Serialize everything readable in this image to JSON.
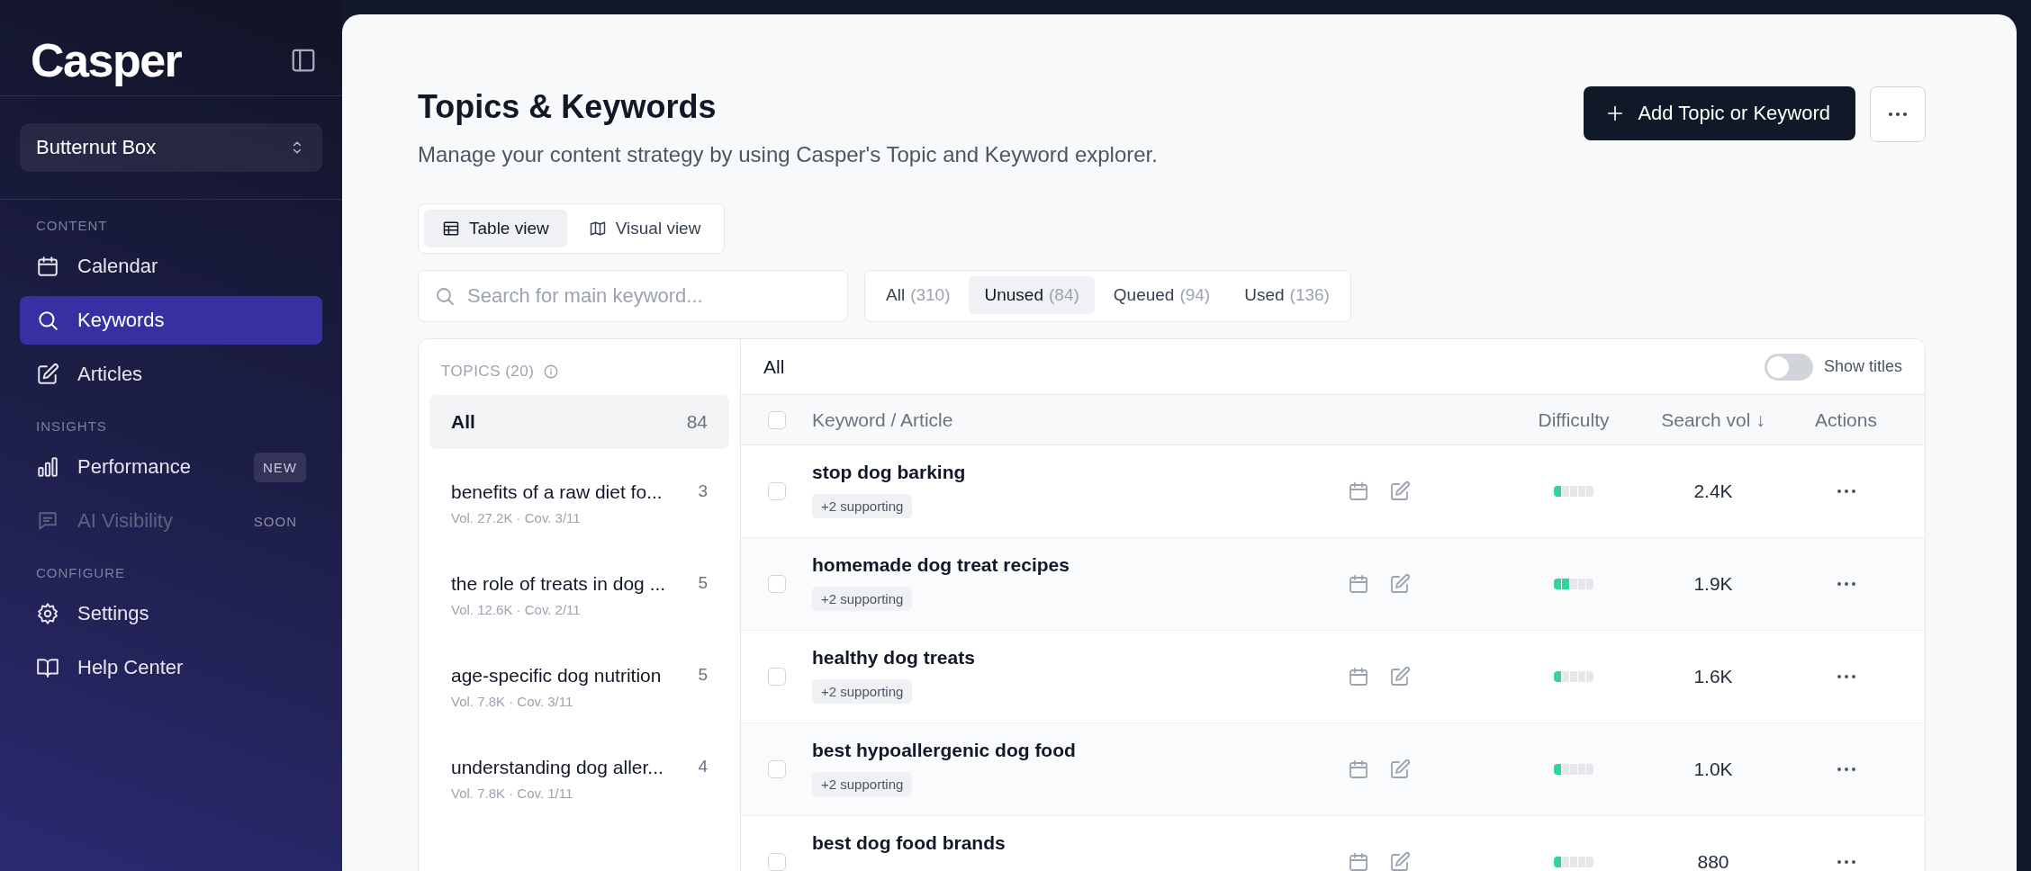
{
  "sidebar": {
    "logo": "Casper",
    "workspace": "Butternut Box",
    "sections": [
      {
        "heading": "CONTENT",
        "items": [
          {
            "label": "Calendar",
            "selected": false,
            "disabled": false
          },
          {
            "label": "Keywords",
            "selected": true,
            "disabled": false
          },
          {
            "label": "Articles",
            "selected": false,
            "disabled": false
          }
        ]
      },
      {
        "heading": "INSIGHTS",
        "items": [
          {
            "label": "Performance",
            "selected": false,
            "disabled": false,
            "badge": "NEW"
          },
          {
            "label": "AI Visibility",
            "selected": false,
            "disabled": true,
            "badge": "SOON"
          }
        ]
      },
      {
        "heading": "CONFIGURE",
        "items": [
          {
            "label": "Settings",
            "selected": false,
            "disabled": false
          },
          {
            "label": "Help Center",
            "selected": false,
            "disabled": false
          }
        ]
      }
    ]
  },
  "page": {
    "title": "Topics & Keywords",
    "subtitle": "Manage your content strategy by using Casper's Topic and Keyword explorer.",
    "add_button": "Add Topic or Keyword",
    "view_tabs": [
      {
        "label": "Table view",
        "selected": true
      },
      {
        "label": "Visual view",
        "selected": false
      }
    ],
    "search": {
      "placeholder": "Search for main keyword..."
    },
    "filters": [
      {
        "label": "All",
        "count": "(310)",
        "selected": false
      },
      {
        "label": "Unused",
        "count": "(84)",
        "selected": true
      },
      {
        "label": "Queued",
        "count": "(94)",
        "selected": false
      },
      {
        "label": "Used",
        "count": "(136)",
        "selected": false
      }
    ]
  },
  "topics": {
    "heading": "TOPICS (20)",
    "items": [
      {
        "title": "All",
        "count": "84",
        "selected": true
      },
      {
        "title": "benefits of a raw diet fo...",
        "meta": "Vol. 27.2K · Cov. 3/11",
        "count": "3",
        "selected": false
      },
      {
        "title": "the role of treats in dog ...",
        "meta": "Vol. 12.6K · Cov. 2/11",
        "count": "5",
        "selected": false
      },
      {
        "title": "age-specific dog nutrition",
        "meta": "Vol. 7.8K · Cov. 3/11",
        "count": "5",
        "selected": false
      },
      {
        "title": "understanding dog aller...",
        "meta": "Vol. 7.8K · Cov. 1/11",
        "count": "4",
        "selected": false
      }
    ]
  },
  "table": {
    "title": "All",
    "show_titles": {
      "label": "Show titles",
      "on": false
    },
    "select_all_checked": false,
    "columns": [
      "Keyword / Article",
      "Difficulty",
      "Search vol ↓",
      "Actions"
    ],
    "rows": [
      {
        "keyword": "stop dog barking",
        "tag": "+2 supporting",
        "checked": false,
        "level": 0.2,
        "search_vol": "2.4K"
      },
      {
        "keyword": "homemade dog treat recipes",
        "tag": "+2 supporting",
        "checked": false,
        "level": 0.4,
        "search_vol": "1.9K"
      },
      {
        "keyword": "healthy dog treats",
        "tag": "+2 supporting",
        "checked": false,
        "level": 0.2,
        "search_vol": "1.6K"
      },
      {
        "keyword": "best hypoallergenic dog food",
        "tag": "+2 supporting",
        "checked": false,
        "level": 0.2,
        "search_vol": "1.0K"
      },
      {
        "keyword": "best dog food brands",
        "checked": false,
        "level": 0.2,
        "search_vol": "880"
      }
    ]
  }
}
